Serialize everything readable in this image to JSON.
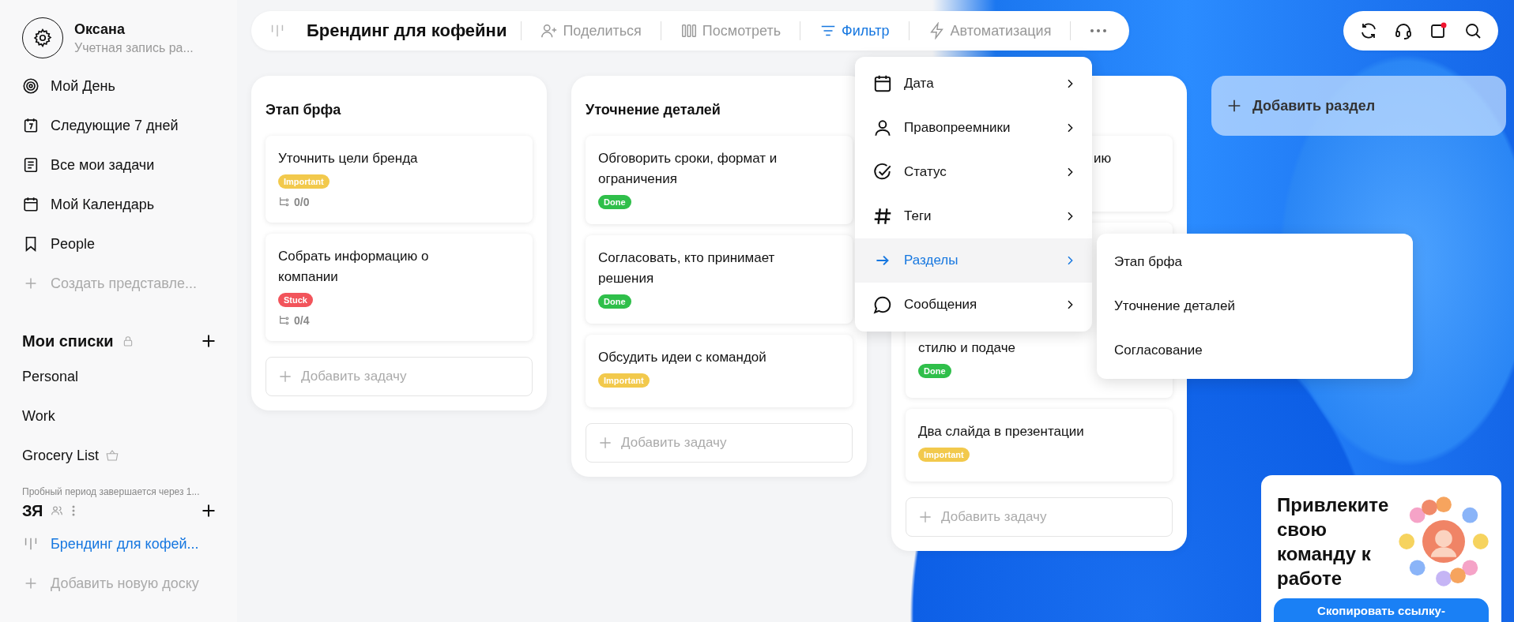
{
  "sidebar": {
    "user": {
      "name": "Оксана",
      "subtitle": "Учетная запись ра..."
    },
    "nav": [
      {
        "label": "Мой День",
        "kind": "view"
      },
      {
        "label": "Следующие 7 дней",
        "kind": "view"
      },
      {
        "label": "Все мои задачи",
        "kind": "view"
      },
      {
        "label": "Мой Календарь",
        "kind": "view"
      },
      {
        "label": "People",
        "kind": "view"
      },
      {
        "label": "Создать представле...",
        "kind": "add"
      }
    ],
    "lists_title": "Мои списки",
    "lists": [
      {
        "label": "Personal",
        "kind": "plain"
      },
      {
        "label": "Work",
        "kind": "plain"
      },
      {
        "label": "Grocery List",
        "kind": "with-icon"
      }
    ],
    "trial_notice": "Пробный период завершается через 1...",
    "workspace_title": "ЗЯ",
    "boards": [
      {
        "label": "Брендинг для кофей...",
        "kind": "board",
        "selected": true
      },
      {
        "label": "Добавить новую доску",
        "kind": "add",
        "selected": false
      }
    ]
  },
  "toolbar": {
    "title": "Брендинг для кофейни",
    "actions": [
      {
        "label": "Поделиться",
        "selected": false
      },
      {
        "label": "Посмотреть",
        "selected": false
      },
      {
        "label": "Фильтр",
        "selected": true
      },
      {
        "label": "Автоматизация",
        "selected": false
      }
    ]
  },
  "columns": [
    {
      "title": "Этап брфа",
      "add_label": "Добавить задачу",
      "cards": [
        {
          "title": "Уточнить цели бренда",
          "tag": {
            "label": "Important",
            "color": "#f2c94c"
          },
          "subtasks": "0/0"
        },
        {
          "title": "Собрать информацию о компании",
          "tag": {
            "label": "Stuck",
            "color": "#f2545b"
          },
          "subtasks": "0/4"
        }
      ]
    },
    {
      "title": "Уточнение деталей",
      "add_label": "Добавить задачу",
      "cards": [
        {
          "title": "Обговорить сроки, формат и ограничения",
          "tag": {
            "label": "Done",
            "color": "#2fbf4a"
          }
        },
        {
          "title": "Согласовать, кто принимает решения",
          "tag": {
            "label": "Done",
            "color": "#2fbf4a"
          }
        },
        {
          "title": "Обсудить идеи с командой",
          "tag": {
            "label": "Important",
            "color": "#f2c94c"
          }
        }
      ]
    },
    {
      "add_label": "Добавить задачу",
      "cards": [
        {
          "title": "ию"
        },
        {
          "title": "стилю и подаче",
          "tag": {
            "label": "Done",
            "color": "#2fbf4a"
          }
        },
        {
          "title": "Два слайда в презентации",
          "tag": {
            "label": "Important",
            "color": "#f2c94c"
          }
        }
      ]
    }
  ],
  "add_section": {
    "label": "Добавить раздел"
  },
  "filter_menu": {
    "items": [
      {
        "label": "Дата",
        "selected": false
      },
      {
        "label": "Правопреемники",
        "selected": false
      },
      {
        "label": "Статус",
        "selected": false
      },
      {
        "label": "Теги",
        "selected": false
      },
      {
        "label": "Разделы",
        "selected": true
      },
      {
        "label": "Сообщения",
        "selected": false
      }
    ]
  },
  "sections_menu": {
    "items": [
      {
        "label": "Этап брфа"
      },
      {
        "label": "Уточнение деталей"
      },
      {
        "label": "Согласование"
      }
    ]
  },
  "promo": {
    "title": "Привлеките свою команду к работе",
    "button": "Скопировать ссылку-"
  }
}
